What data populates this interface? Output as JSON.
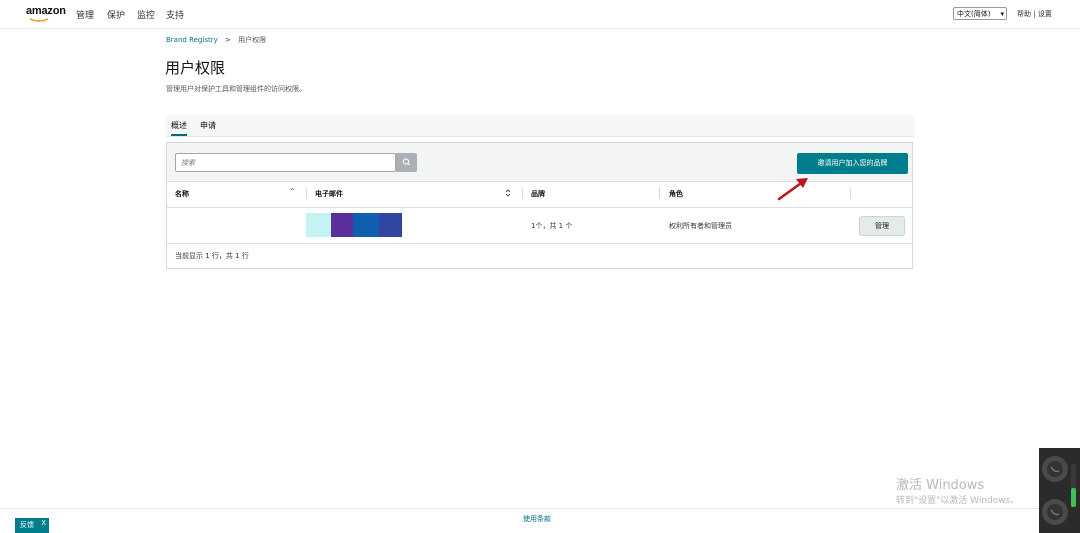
{
  "header": {
    "logo": "amazon",
    "nav": [
      "管理",
      "保护",
      "监控",
      "支持"
    ],
    "language": "中文(简体)",
    "help": "帮助",
    "separator": "|",
    "settings": "设置"
  },
  "breadcrumb": {
    "root": "Brand Registry",
    "separator": ">",
    "current": "用户权限"
  },
  "page": {
    "title": "用户权限",
    "description": "管理用户对保护工具和管理组件的访问权限。"
  },
  "tabs": [
    {
      "label": "概述",
      "active": true
    },
    {
      "label": "申请",
      "active": false
    }
  ],
  "toolbar": {
    "search_placeholder": "搜索",
    "invite_label": "邀请用户加入您的品牌"
  },
  "table": {
    "columns": [
      "名称",
      "电子邮件",
      "品牌",
      "角色"
    ],
    "rows": [
      {
        "brands": "1个，共 1 个",
        "role": "权利所有者和管理员",
        "action": "管理"
      }
    ],
    "footer": "当前显示 1 行，共 1 行"
  },
  "footer": {
    "link": "使用条款",
    "feedback": "反馈",
    "feedback_close": "X"
  },
  "windows_watermark": {
    "title": "激活 Windows",
    "subtitle": "转到\"设置\"以激活 Windows。"
  },
  "colors": {
    "accent": "#007e8c",
    "link": "#007185",
    "annotation_arrow": "#b8141a"
  }
}
